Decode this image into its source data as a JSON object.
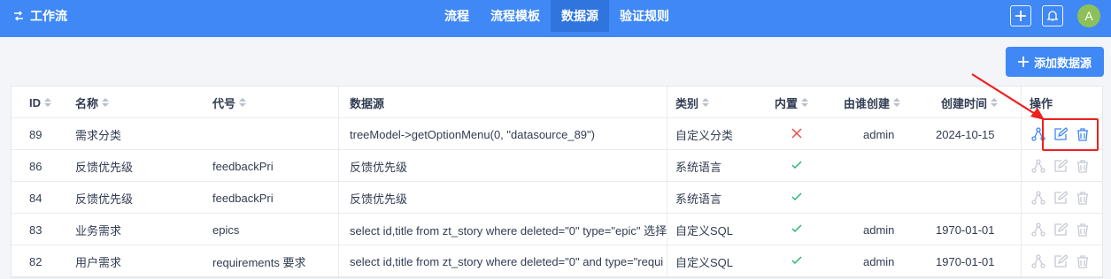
{
  "topbar": {
    "brand": "工作流",
    "nav": [
      {
        "label": "流程",
        "active": false
      },
      {
        "label": "流程模板",
        "active": false
      },
      {
        "label": "数据源",
        "active": true
      },
      {
        "label": "验证规则",
        "active": false
      }
    ],
    "avatar_letter": "A",
    "icons": [
      "workflow-icon",
      "plus-icon",
      "bell-icon"
    ]
  },
  "actions": {
    "add_label": "添加数据源"
  },
  "table": {
    "headers": {
      "id": "ID",
      "name": "名称",
      "code": "代号",
      "source": "数据源",
      "type": "类别",
      "builtin": "内置",
      "creator": "由谁创建",
      "created": "创建时间",
      "ops": "操作"
    },
    "rows": [
      {
        "id": "89",
        "name": "需求分类",
        "code": "",
        "source": "treeModel->getOptionMenu(0, \"datasource_89\")",
        "type": "自定义分类",
        "builtin": false,
        "creator": "admin",
        "created": "2024-10-15",
        "enabled": true
      },
      {
        "id": "86",
        "name": "反馈优先级",
        "code": "feedbackPri",
        "source": "反馈优先级",
        "type": "系统语言",
        "builtin": true,
        "creator": "",
        "created": "",
        "enabled": false
      },
      {
        "id": "84",
        "name": "反馈优先级",
        "code": "feedbackPri",
        "source": "反馈优先级",
        "type": "系统语言",
        "builtin": true,
        "creator": "",
        "created": "",
        "enabled": false
      },
      {
        "id": "83",
        "name": "业务需求",
        "code": "epics",
        "source": "select id,title from zt_story where deleted=\"0\" type=\"epic\"  选择",
        "type": "自定义SQL",
        "builtin": true,
        "creator": "admin",
        "created": "1970-01-01",
        "enabled": false
      },
      {
        "id": "82",
        "name": "用户需求",
        "code": "requirements  要求",
        "source": "select id,title from zt_story where deleted=\"0\" and type=\"requi",
        "type": "自定义SQL",
        "builtin": true,
        "creator": "admin",
        "created": "1970-01-01",
        "enabled": false
      }
    ]
  },
  "colors": {
    "primary": "#3f88f5",
    "nav_active": "#2f75dd",
    "check": "#2fb27a",
    "cross": "#e84c4c",
    "annotation": "#f0201f",
    "icon_enabled": "#3f88f5",
    "icon_disabled": "#c5cad3"
  }
}
